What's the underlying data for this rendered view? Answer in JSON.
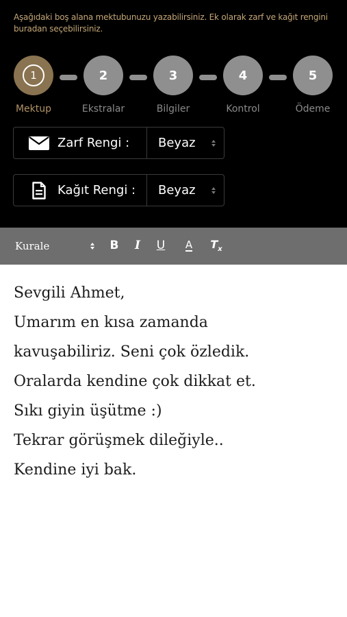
{
  "intro_text": "Aşağıdaki boş alana mektubunuzu yazabilirsiniz. Ek olarak zarf ve kağıt rengini buradan seçebilirsiniz.",
  "steps": [
    {
      "number": "1",
      "label": "Mektup",
      "active": true
    },
    {
      "number": "2",
      "label": "Ekstralar",
      "active": false
    },
    {
      "number": "3",
      "label": "Bilgiler",
      "active": false
    },
    {
      "number": "4",
      "label": "Kontrol",
      "active": false
    },
    {
      "number": "5",
      "label": "Ödeme",
      "active": false
    }
  ],
  "envelope": {
    "label": "Zarf Rengi :",
    "value": "Beyaz",
    "icon": "envelope-icon"
  },
  "paper": {
    "label": "Kağıt Rengi :",
    "value": "Beyaz",
    "icon": "document-icon"
  },
  "toolbar": {
    "font": "Kurale",
    "bold": "B",
    "italic": "I",
    "underline": "U",
    "font_color": "A",
    "clear_format": "T"
  },
  "letter_lines": [
    "Sevgili Ahmet,",
    "Umarım en kısa zamanda",
    "kavuşabiliriz. Seni çok özledik.",
    "Oralarda kendine çok dikkat et.",
    "Sıkı giyin üşütme :)",
    "Tekrar görüşmek dileğiyle..",
    "Kendine iyi bak."
  ],
  "colors": {
    "accent": "#c5a777",
    "active_step": "#8a7350",
    "inactive_step": "#8f8f8f",
    "toolbar": "#6e6e6e"
  }
}
